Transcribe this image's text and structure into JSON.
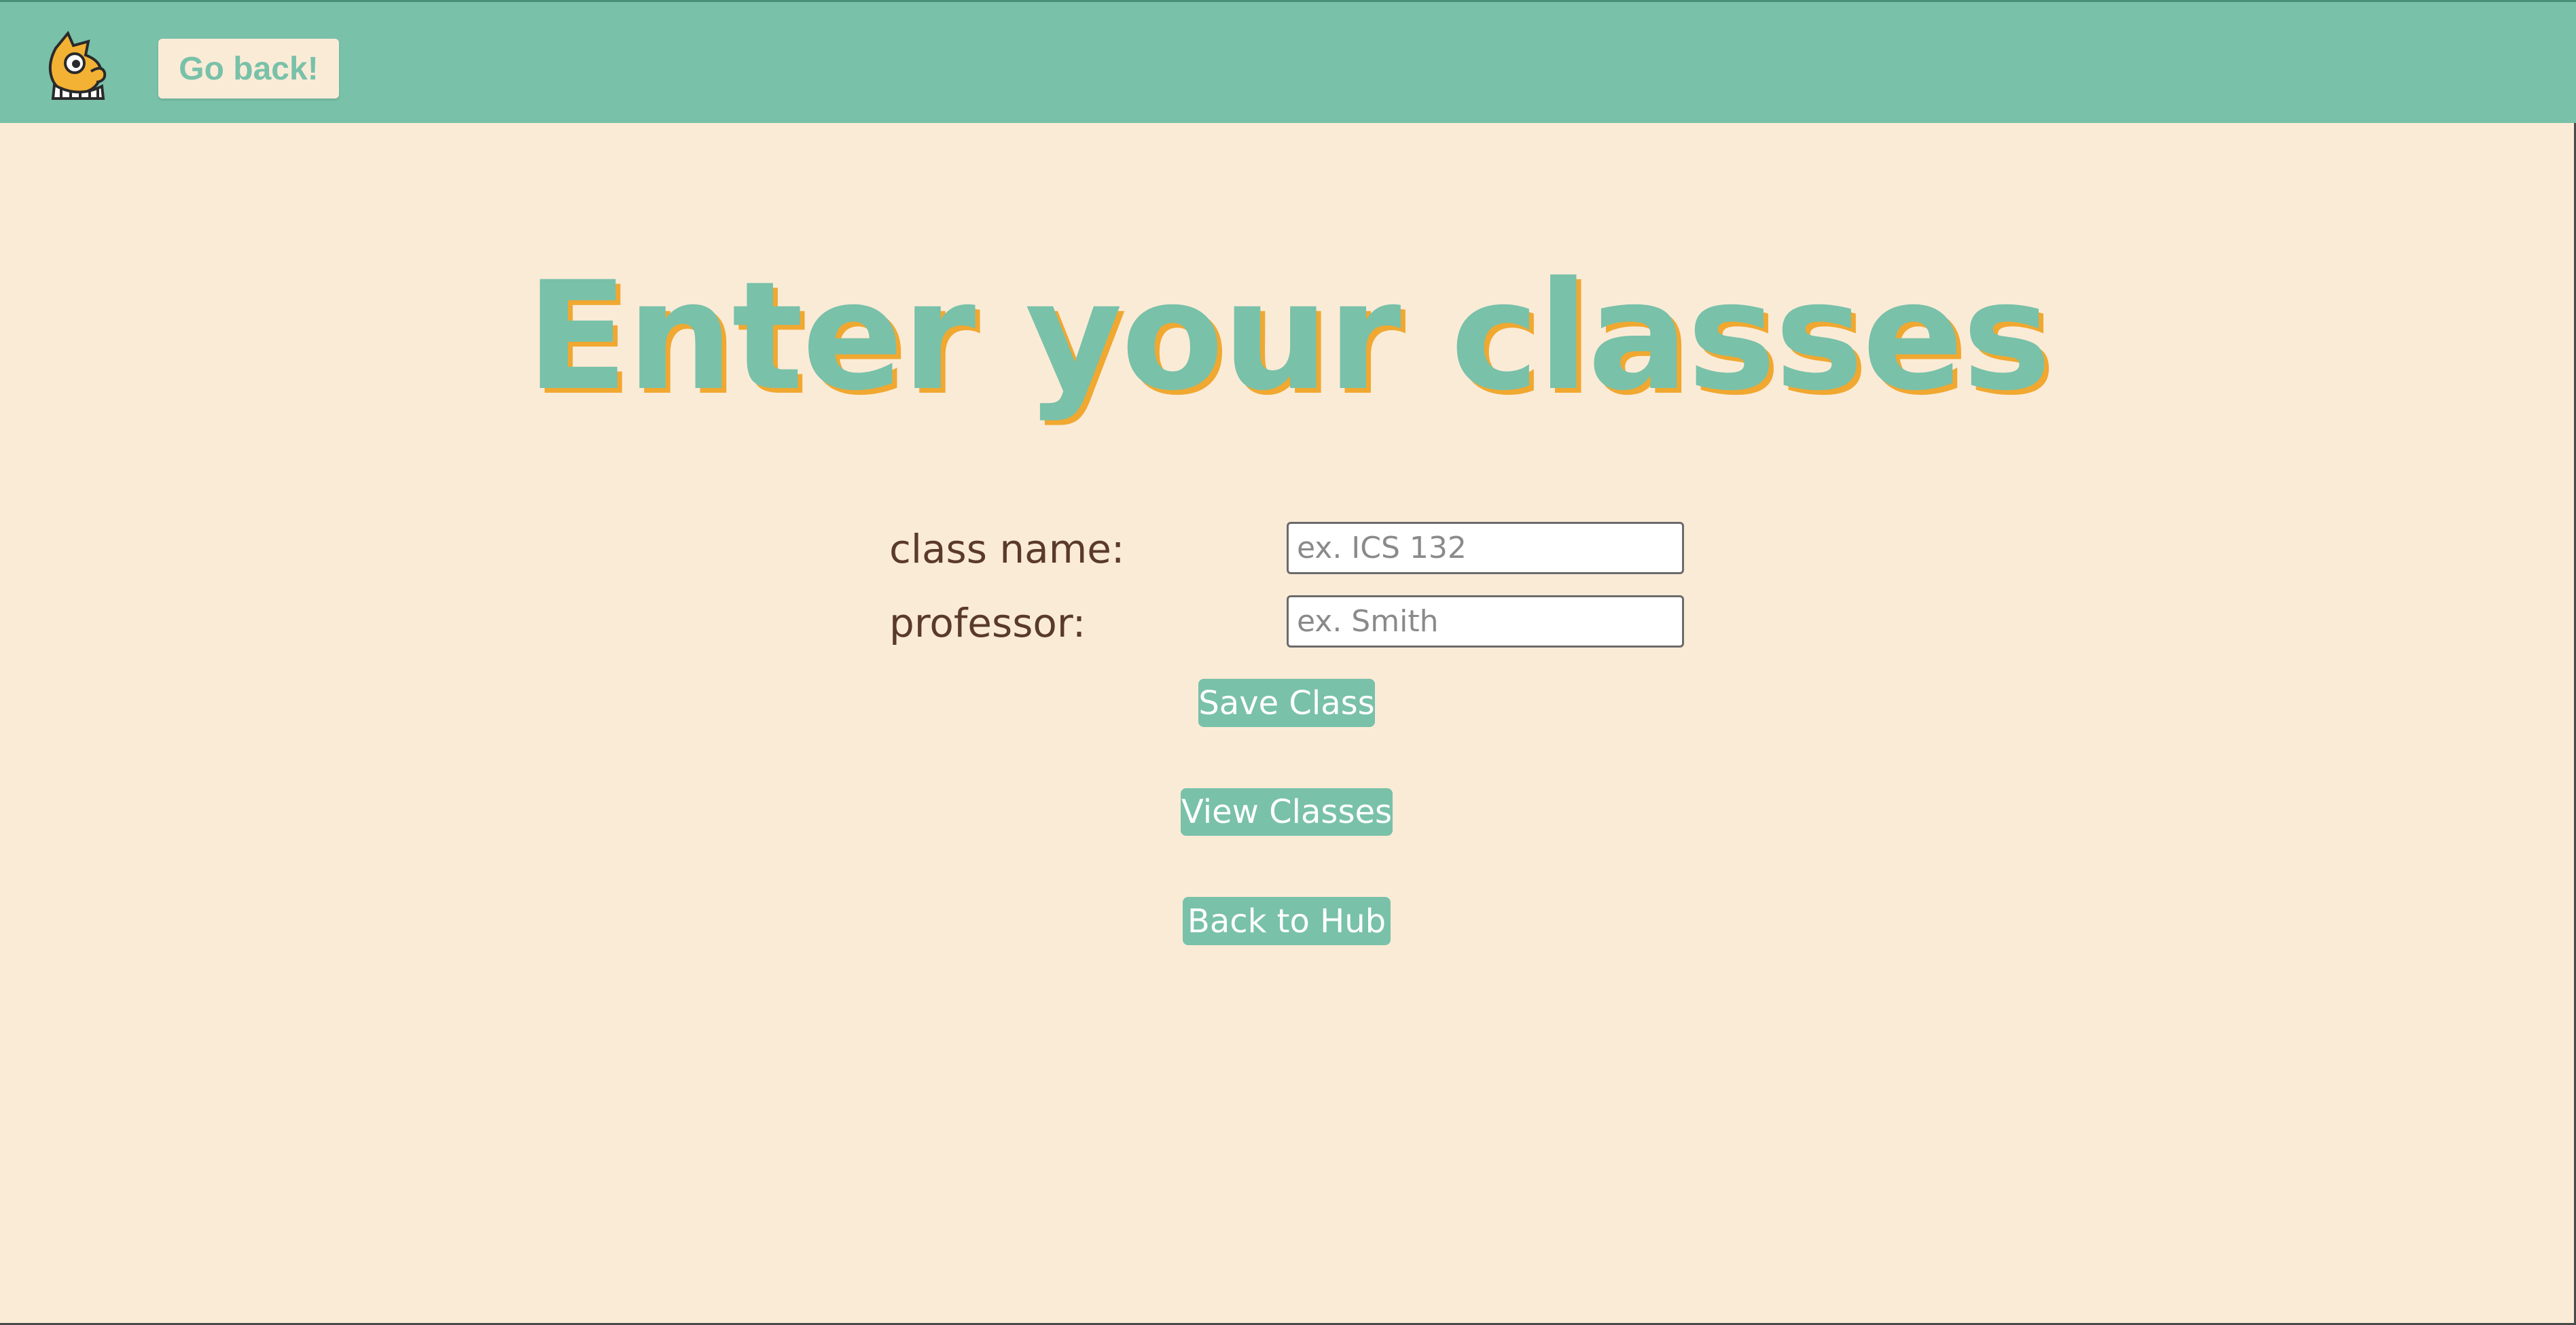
{
  "header": {
    "logo_icon": "cartoon-mascot-logo-icon",
    "go_back_label": "Go back!"
  },
  "main": {
    "title": "Enter your classes",
    "form": {
      "class_name_label": "class name:",
      "class_name_placeholder": "ex. ICS 132",
      "class_name_value": "",
      "professor_label": "professor:",
      "professor_placeholder": "ex. Smith",
      "professor_value": ""
    },
    "buttons": {
      "save_label": "Save Class",
      "view_label": "View Classes",
      "hub_label": "Back to Hub"
    }
  },
  "colors": {
    "accent": "#79c1a9",
    "background": "#faebd7",
    "title_shadow": "#f0a830",
    "label_text": "#5a3a2a"
  }
}
